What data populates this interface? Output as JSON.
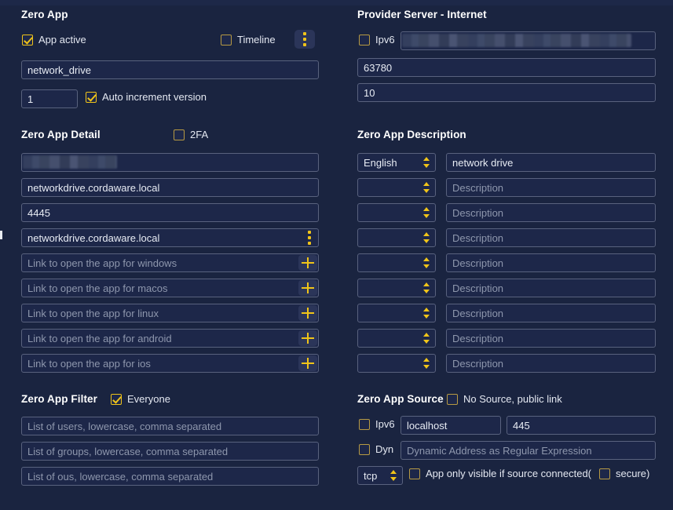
{
  "app": {
    "background_color": "#1a2440",
    "accent_color": "#f0c419",
    "field_border_color": "#59627e"
  },
  "left_column": {
    "zero_app": {
      "title": "Zero App",
      "app_active": {
        "label": "App active",
        "checked": true
      },
      "timeline": {
        "label": "Timeline",
        "checked": false
      },
      "menu_icon": "vertical-dots-icon",
      "name_field": {
        "value": "network_drive",
        "placeholder": ""
      },
      "version_field": {
        "value": "1",
        "placeholder": ""
      },
      "auto_increment": {
        "label": "Auto increment version",
        "checked": true
      }
    },
    "zero_app_detail": {
      "title": "Zero App Detail",
      "twofa": {
        "label": "2FA",
        "checked": false
      },
      "masked_field": {
        "value": "",
        "redacted": true
      },
      "host_field": {
        "value": "networkdrive.cordaware.local"
      },
      "port_field": {
        "value": "4445"
      },
      "host2_field": {
        "value": "networkdrive.cordaware.local",
        "menu_icon": "vertical-dots-icon"
      },
      "links": [
        {
          "placeholder": "Link to open the app for windows",
          "action_icon": "plus-icon"
        },
        {
          "placeholder": "Link to open the app for macos",
          "action_icon": "plus-icon"
        },
        {
          "placeholder": "Link to open the app for linux",
          "action_icon": "plus-icon"
        },
        {
          "placeholder": "Link to open the app for android",
          "action_icon": "plus-icon"
        },
        {
          "placeholder": "Link to open the app for ios",
          "action_icon": "plus-icon"
        }
      ]
    },
    "zero_app_filter": {
      "title": "Zero App Filter",
      "everyone": {
        "label": "Everyone",
        "checked": true
      },
      "fields": [
        {
          "placeholder": "List of users, lowercase, comma separated"
        },
        {
          "placeholder": "List of groups, lowercase, comma separated"
        },
        {
          "placeholder": "List of ous, lowercase, comma separated"
        }
      ]
    }
  },
  "right_column": {
    "provider_server": {
      "title": "Provider Server - Internet",
      "ipv6": {
        "label": "Ipv6",
        "checked": false
      },
      "address_field": {
        "value": "",
        "redacted": true
      },
      "port_field": {
        "value": "63780"
      },
      "count_field": {
        "value": "10"
      }
    },
    "zero_app_description": {
      "title": "Zero App Description",
      "rows": [
        {
          "language": "English",
          "description": "network drive",
          "description_placeholder": "Description"
        },
        {
          "language": "",
          "description": "",
          "description_placeholder": "Description"
        },
        {
          "language": "",
          "description": "",
          "description_placeholder": "Description"
        },
        {
          "language": "",
          "description": "",
          "description_placeholder": "Description"
        },
        {
          "language": "",
          "description": "",
          "description_placeholder": "Description"
        },
        {
          "language": "",
          "description": "",
          "description_placeholder": "Description"
        },
        {
          "language": "",
          "description": "",
          "description_placeholder": "Description"
        },
        {
          "language": "",
          "description": "",
          "description_placeholder": "Description"
        },
        {
          "language": "",
          "description": "",
          "description_placeholder": "Description"
        }
      ]
    },
    "zero_app_source": {
      "title": "Zero App Source",
      "no_source": {
        "label": "No Source, public link",
        "checked": false
      },
      "ipv6": {
        "label": "Ipv6",
        "checked": false
      },
      "host_field": {
        "value": "localhost"
      },
      "port_field": {
        "value": "445"
      },
      "dyn": {
        "label": "Dyn",
        "checked": false
      },
      "dyn_field": {
        "placeholder": "Dynamic Address as Regular Expression"
      },
      "protocol_select": {
        "value": "tcp"
      },
      "source_connected": {
        "label": "App only visible if source connected(",
        "checked": false
      },
      "secure": {
        "label": "secure)",
        "checked": false
      }
    }
  }
}
